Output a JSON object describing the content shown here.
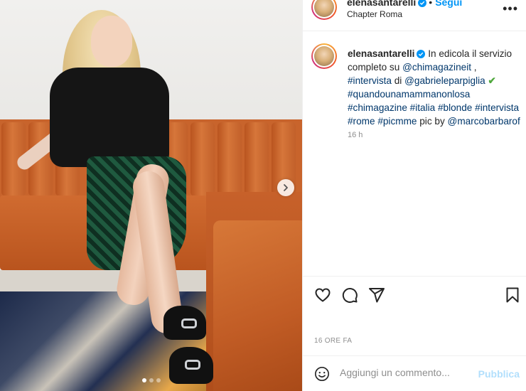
{
  "post": {
    "username": "elenasantarelli",
    "follow_label": "Segui",
    "location": "Chapter Roma",
    "more_label": "•••"
  },
  "caption": {
    "username": "elenasantarelli",
    "text_1": " In edicola il servizio completo su ",
    "mention_1": "@chimagazineit",
    "text_2": " ,",
    "tag_intervista": "#intervista",
    "text_di": " di ",
    "mention_2": "@gabrieleparpiglia",
    "check": "✔",
    "tag_2": "#quandounamammanonlosa",
    "tag_3": "#chimagazine",
    "tag_4": "#italia",
    "tag_5": "#blonde",
    "tag_6": "#intervista",
    "tag_7": "#rome",
    "tag_8": "#picmme",
    "text_pic": " pic by ",
    "mention_3": "@marcobarbarof",
    "time": "16 h"
  },
  "footer": {
    "timestamp": "16 ORE FA",
    "comment_placeholder": "Aggiungi un commento...",
    "publish_label": "Pubblica"
  },
  "carousel": {
    "slides": 3,
    "active_index": 0
  },
  "colors": {
    "link": "#00376b",
    "follow": "#0095f6",
    "publish_disabled": "#b2dffc",
    "verified": "#0095f6"
  },
  "icons": [
    "heart-icon",
    "comment-icon",
    "share-icon",
    "bookmark-icon",
    "emoji-icon",
    "chevron-right-icon",
    "verified-icon",
    "more-icon"
  ]
}
